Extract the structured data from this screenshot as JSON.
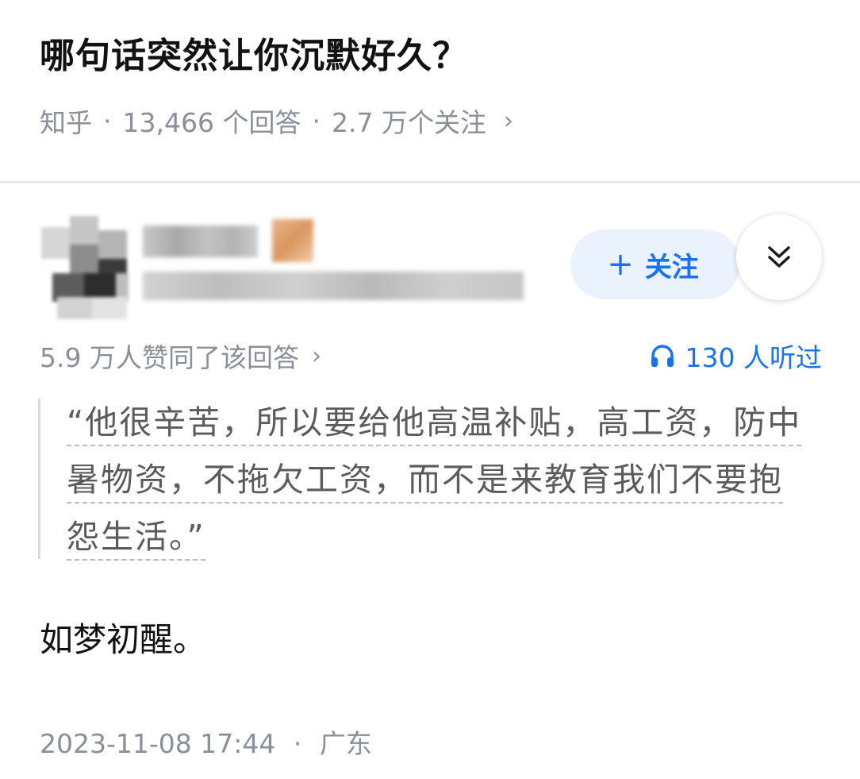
{
  "question": {
    "title": "哪句话突然让你沉默好久？",
    "source": "知乎",
    "separator": "·",
    "answers": "13,466 个回答",
    "followers": "2.7 万个关注",
    "chevron": "›"
  },
  "answer": {
    "follow_label": "关注",
    "follow_icon": "plus-icon",
    "collapse_icon": "double-chevron-down-icon",
    "endorsements": "5.9 万人赞同了该回答",
    "endorse_chevron": "›",
    "listen_icon": "headphones-icon",
    "listens": "130 人听过",
    "quote": "“他很辛苦，所以要给他高温补贴，高工资，防中暑物资，不拖欠工资，而不是来教育我们不要抱怨生活。”",
    "body": "如梦初醒。",
    "date": "2023-11-08 17:44",
    "separator": "·",
    "location": "广东"
  },
  "colors": {
    "accent": "#1772f6",
    "follow_bg": "#eaf2fd",
    "meta_text": "#8a8f99"
  }
}
